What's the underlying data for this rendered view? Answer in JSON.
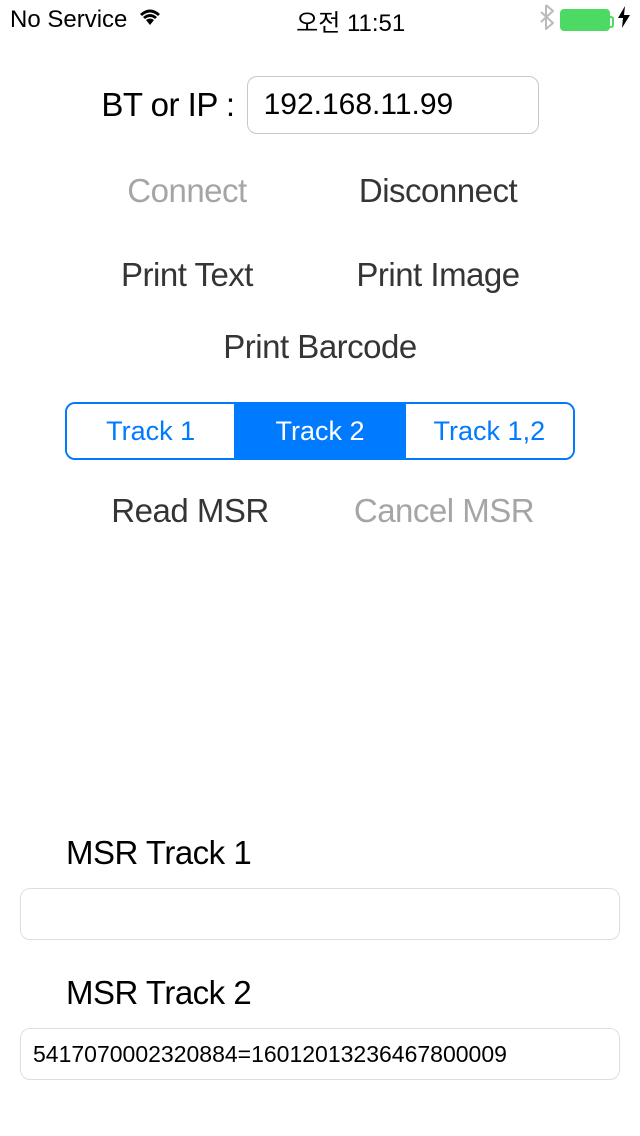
{
  "status": {
    "service": "No Service",
    "time": "오전 11:51"
  },
  "form": {
    "btip_label": "BT or IP :",
    "ip_value": "192.168.11.99"
  },
  "buttons": {
    "connect": "Connect",
    "disconnect": "Disconnect",
    "print_text": "Print Text",
    "print_image": "Print Image",
    "print_barcode": "Print Barcode",
    "read_msr": "Read MSR",
    "cancel_msr": "Cancel MSR"
  },
  "segments": {
    "track1": "Track 1",
    "track2": "Track 2",
    "track12": "Track 1,2",
    "selected": "track2"
  },
  "msr": {
    "track1_label": "MSR Track 1",
    "track1_value": "",
    "track2_label": "MSR Track 2",
    "track2_value": "5417070002320884=16012013236467800009"
  }
}
